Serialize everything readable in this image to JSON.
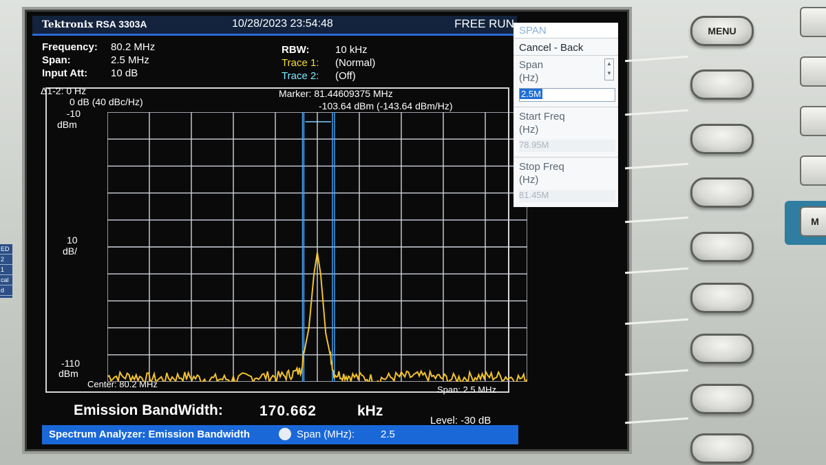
{
  "header": {
    "brand": "Tektronix",
    "model": "RSA 3303A",
    "datetime": "10/28/2023 23:54:48",
    "run_state": "FREE RUN"
  },
  "params_left": [
    {
      "key": "Frequency:",
      "value": "80.2 MHz"
    },
    {
      "key": "Span:",
      "value": "2.5 MHz"
    },
    {
      "key": "Input Att:",
      "value": "10 dB"
    }
  ],
  "params_right": {
    "rbw_key": "RBW:",
    "rbw_value": "10 kHz",
    "trace1_key": "Trace 1:",
    "trace1_value": "(Normal)",
    "trace2_key": "Trace 2:",
    "trace2_value": "(Off)"
  },
  "plot": {
    "delta": "Δ1-2: 0 Hz",
    "delta_level": "0 dB (40 dBc/Hz)",
    "marker_freq": "Marker: 81.44609375 MHz",
    "marker_level": "-103.64 dBm (-143.64 dBm/Hz)",
    "ref_top": "-10",
    "ref_top_unit": "dBm",
    "scale": "10",
    "scale_unit": "dB/",
    "ref_bottom": "-110",
    "ref_bottom_unit": "dBm",
    "center": "Center: 80.2 MHz",
    "span": "Span: 2.5 MHz"
  },
  "chart_data": {
    "type": "line",
    "xlabel": "",
    "ylabel": "",
    "xlim": [
      78.95,
      81.45
    ],
    "ylim": [
      -110,
      -10
    ],
    "x_unit": "MHz",
    "y_unit": "dBm",
    "grid": true,
    "series": [
      {
        "x": [
          78.95,
          79.1,
          79.25,
          79.4,
          79.55,
          79.7,
          79.85,
          80.0,
          80.1,
          80.15,
          80.18,
          80.2,
          80.22,
          80.25,
          80.3,
          80.4,
          80.55,
          80.7,
          80.85,
          81.0,
          81.15,
          81.3,
          81.45
        ],
        "y": [
          -108,
          -108,
          -109,
          -108,
          -109,
          -109,
          -108,
          -108,
          -106,
          -90,
          -70,
          -62,
          -70,
          -92,
          -107,
          -108,
          -109,
          -108,
          -108,
          -109,
          -108,
          -108,
          -109
        ],
        "color": "#f2c230"
      }
    ]
  },
  "markers": {
    "band_left": 80.12,
    "band_right": 80.29
  },
  "measurement": {
    "label": "Emission BandWidth:",
    "value": "170.662",
    "unit": "kHz",
    "level": "Level:  -30 dB"
  },
  "status": {
    "mode": "Spectrum Analyzer: Emission Bandwidth",
    "span_label": "Span (MHz):",
    "span_value": "2.5"
  },
  "side_menu": {
    "title": "SPAN",
    "cancel_back": "Cancel - Back",
    "span_label": "Span",
    "span_unit": "(Hz)",
    "span_value": "2.5M",
    "start_label": "Start Freq",
    "start_unit": "(Hz)",
    "start_value": "78.95M",
    "stop_label": "Stop Freq",
    "stop_unit": "(Hz)",
    "stop_value": "81.45M"
  },
  "hardware": {
    "menu_key": "MENU",
    "right_key_m": "M"
  },
  "left_strip": [
    "ED",
    "2",
    "1",
    "cal",
    "d"
  ]
}
